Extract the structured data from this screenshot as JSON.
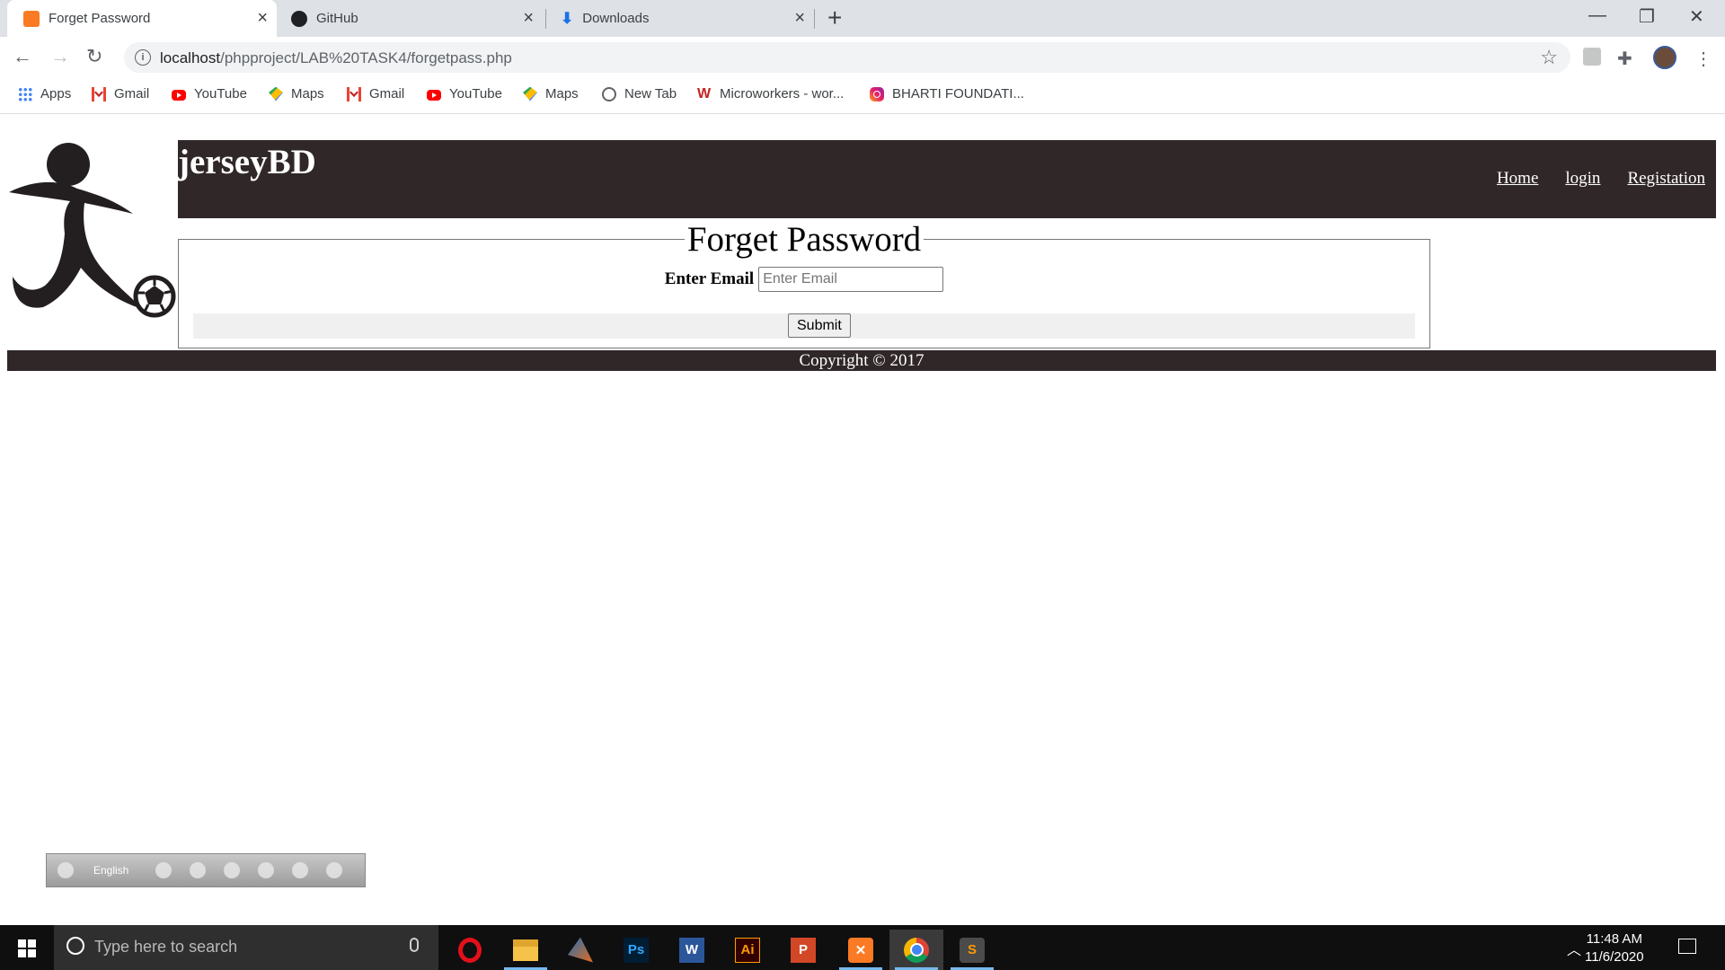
{
  "browser": {
    "tabs": [
      {
        "title": "Forget Password",
        "icon": "xampp-icon",
        "active": true
      },
      {
        "title": "GitHub",
        "icon": "github-icon",
        "active": false
      },
      {
        "title": "Downloads",
        "icon": "download-icon",
        "active": false
      }
    ],
    "url_host": "localhost",
    "url_path": "/phpproject/LAB%20TASK4/forgetpass.php",
    "bookmarks": [
      {
        "label": "Apps",
        "icon": "apps-icon"
      },
      {
        "label": "Gmail",
        "icon": "gmail-icon"
      },
      {
        "label": "YouTube",
        "icon": "youtube-icon"
      },
      {
        "label": "Maps",
        "icon": "maps-icon"
      },
      {
        "label": "Gmail",
        "icon": "gmail-icon"
      },
      {
        "label": "YouTube",
        "icon": "youtube-icon"
      },
      {
        "label": "Maps",
        "icon": "maps-icon"
      },
      {
        "label": "New Tab",
        "icon": "globe-icon"
      },
      {
        "label": "Microworkers - wor...",
        "icon": "microworkers-icon"
      },
      {
        "label": "BHARTI FOUNDATI...",
        "icon": "instagram-icon"
      }
    ]
  },
  "site": {
    "title": "jerseyBD",
    "nav": [
      "Home",
      "login",
      "Registation"
    ],
    "form": {
      "legend": "Forget Password",
      "email_label": "Enter Email",
      "email_placeholder": "Enter Email",
      "email_value": "",
      "submit_label": "Submit"
    },
    "footer": "Copyright © 2017",
    "colors": {
      "header_bg": "#302728",
      "footer_bg": "#302728"
    }
  },
  "language_bar": {
    "language": "English"
  },
  "taskbar": {
    "search_placeholder": "Type here to search",
    "apps": [
      "opera-icon",
      "file-explorer-icon",
      "matlab-icon",
      "photoshop-icon",
      "word-icon",
      "illustrator-icon",
      "powerpoint-icon",
      "xampp-icon",
      "chrome-icon",
      "sublime-text-icon"
    ],
    "time": "11:48 AM",
    "date": "11/6/2020"
  }
}
